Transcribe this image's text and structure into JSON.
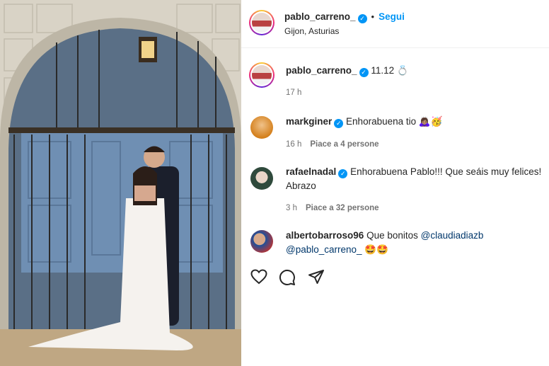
{
  "post": {
    "username": "pablo_carreno_",
    "follow_label": "Segui",
    "separator": "•",
    "location": "Gijon, Asturias"
  },
  "caption": {
    "username": "pablo_carreno_",
    "text": "11.12 💍",
    "time": "17 h"
  },
  "comments": [
    {
      "username": "markginer",
      "text": "Enhorabuena tio 🙇🏽‍♀️🥳",
      "time": "16 h",
      "likes": "Piace a 4 persone"
    },
    {
      "username": "rafaelnadal",
      "text": "Enhorabuena Pablo!!! Que seáis muy felices! Abrazo",
      "time": "3 h",
      "likes": "Piace a 32 persone"
    },
    {
      "username": "albertobarroso96",
      "text": "Que bonitos ",
      "mention1": "@claudiadiazb",
      "mention2": "@pablo_carreno_",
      "emoji": " 🤩🤩"
    }
  ],
  "icons": {
    "like": "heart-icon",
    "comment": "comment-icon",
    "share": "share-icon",
    "verified": "verified-badge-icon"
  },
  "colors": {
    "accent": "#0095f6",
    "text": "#262626",
    "muted": "#737373"
  }
}
